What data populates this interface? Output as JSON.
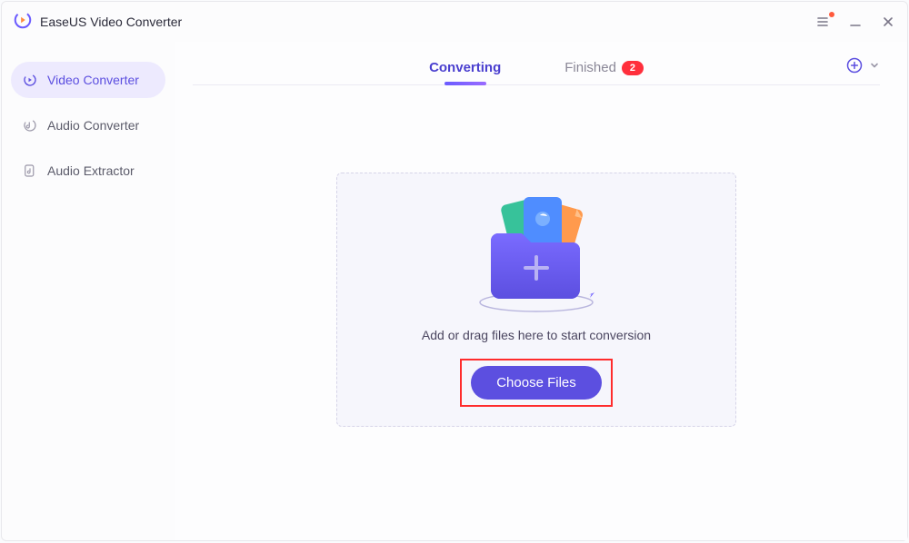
{
  "app": {
    "title": "EaseUS Video Converter"
  },
  "sidebar": {
    "items": [
      {
        "label": "Video Converter",
        "active": true
      },
      {
        "label": "Audio Converter",
        "active": false
      },
      {
        "label": "Audio Extractor",
        "active": false
      }
    ]
  },
  "tabs": {
    "converting": "Converting",
    "finished": "Finished",
    "finished_count": "2"
  },
  "dropzone": {
    "hint": "Add or drag files here to start conversion",
    "choose_label": "Choose Files"
  },
  "colors": {
    "accent": "#5c4fe0",
    "badge": "#ff2f3c"
  }
}
